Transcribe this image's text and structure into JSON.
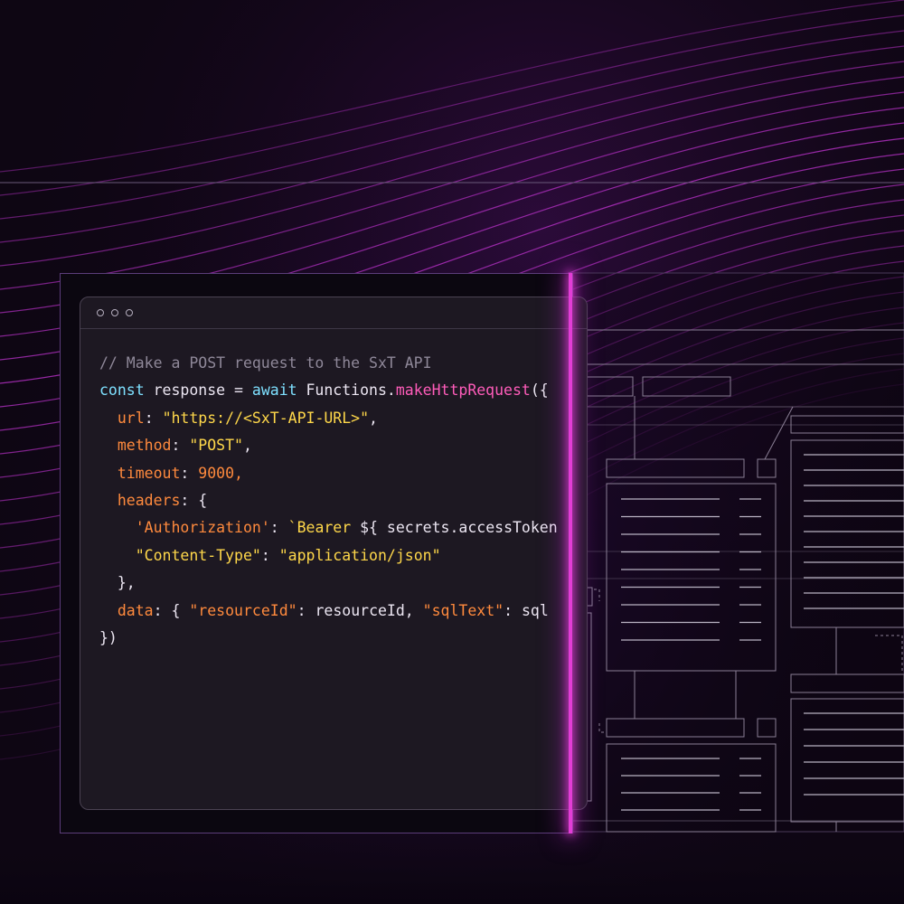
{
  "colors": {
    "background": "#0e0613",
    "accent": "#e23dd6",
    "editor_bg": "#1d1822",
    "keyword": "#7ee0ff",
    "function": "#ff5cba",
    "property": "#ff8a3d",
    "string": "#ffd84a",
    "comment": "#8f8899"
  },
  "icons": [
    "window-dot-icon"
  ],
  "code": {
    "l1": {
      "comment": "// Make a POST request to the SxT API"
    },
    "l2": {
      "kw1": "const",
      "t1": " response = ",
      "kw2": "await",
      "t2": " Functions.",
      "fn": "makeHttpRequest",
      "t3": "({"
    },
    "l3": {
      "indent": "  ",
      "prop": "url",
      "colon": ": ",
      "str": "\"https://<SxT-API-URL>\"",
      "end": ","
    },
    "l4": {
      "indent": "  ",
      "prop": "method",
      "colon": ": ",
      "str": "\"POST\"",
      "end": ","
    },
    "l5": {
      "indent": "  ",
      "prop": "timeout",
      "colon": ": ",
      "num": "9000,"
    },
    "l6": {
      "indent": "  ",
      "prop": "headers",
      "colon": ": ",
      "end": "{"
    },
    "l7": {
      "indent": "    ",
      "key": "'Authorization'",
      "colon": ": ",
      "tpl": "`Bearer ",
      "rest": "${ secrets.accessToken"
    },
    "l8": {
      "indent": "    ",
      "key": "\"Content-Type\"",
      "colon": ": ",
      "str": "\"application/json\""
    },
    "l9": {
      "indent": "  ",
      "end": "},"
    },
    "l10": {
      "indent": "  ",
      "prop": "data",
      "t1": ": { ",
      "k1": "\"resourceId\"",
      "t2": ": resourceId, ",
      "k2": "\"sqlText\"",
      "t3": ": sql"
    },
    "l11": {
      "end": "})"
    }
  }
}
